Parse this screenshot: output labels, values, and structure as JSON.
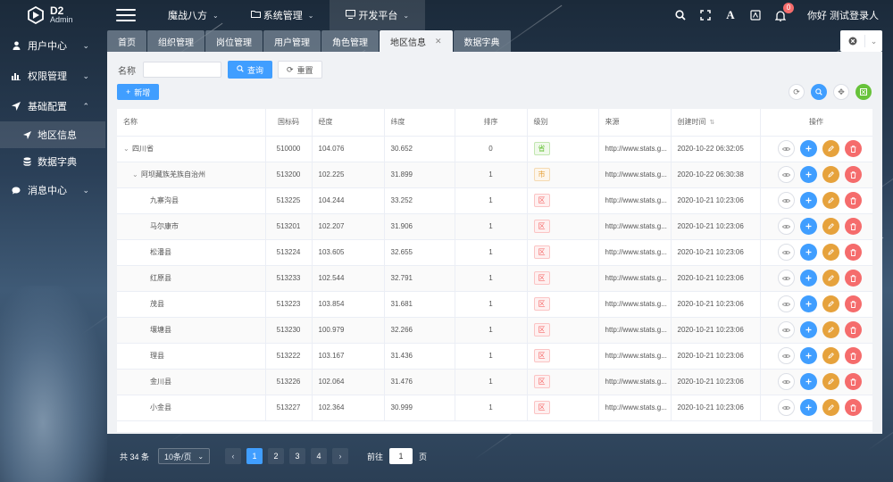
{
  "app": {
    "logo_title": "D2",
    "logo_subtitle": "Admin"
  },
  "top_nav": [
    {
      "label": "魔战八方",
      "active": false
    },
    {
      "label": "系统管理",
      "active": false
    },
    {
      "label": "开发平台",
      "active": true
    }
  ],
  "header": {
    "notification_count": "0",
    "greeting": "你好 测试登录人"
  },
  "sidebar": {
    "items": [
      {
        "label": "用户中心"
      },
      {
        "label": "权限管理"
      },
      {
        "label": "基础配置"
      },
      {
        "label": "地区信息"
      },
      {
        "label": "数据字典"
      },
      {
        "label": "消息中心"
      }
    ]
  },
  "tabs": [
    {
      "label": "首页"
    },
    {
      "label": "组织管理"
    },
    {
      "label": "岗位管理"
    },
    {
      "label": "用户管理"
    },
    {
      "label": "角色管理"
    },
    {
      "label": "地区信息",
      "active": true
    },
    {
      "label": "数据字典"
    }
  ],
  "search": {
    "label": "名称",
    "placeholder": "",
    "query_label": "查询",
    "reset_label": "重置"
  },
  "toolbar": {
    "add_label": "新增"
  },
  "table": {
    "columns": [
      "名称",
      "国标码",
      "经度",
      "纬度",
      "排序",
      "级别",
      "来源",
      "创建时间",
      "操作"
    ],
    "rows": [
      {
        "name": "四川省",
        "code": "510000",
        "lng": "104.076",
        "lat": "30.652",
        "sort": "0",
        "level": "省",
        "level_type": "green",
        "source": "http://www.stats.g...",
        "created": "2020-10-22 06:32:05",
        "indent": 0,
        "arrow": "⌄"
      },
      {
        "name": "阿坝藏族羌族自治州",
        "code": "513200",
        "lng": "102.225",
        "lat": "31.899",
        "sort": "1",
        "level": "市",
        "level_type": "orange",
        "source": "http://www.stats.g...",
        "created": "2020-10-22 06:30:38",
        "indent": 1,
        "arrow": "⌄"
      },
      {
        "name": "九寨沟县",
        "code": "513225",
        "lng": "104.244",
        "lat": "33.252",
        "sort": "1",
        "level": "区",
        "level_type": "red",
        "source": "http://www.stats.g...",
        "created": "2020-10-21 10:23:06",
        "indent": 2,
        "arrow": ""
      },
      {
        "name": "马尔康市",
        "code": "513201",
        "lng": "102.207",
        "lat": "31.906",
        "sort": "1",
        "level": "区",
        "level_type": "red",
        "source": "http://www.stats.g...",
        "created": "2020-10-21 10:23:06",
        "indent": 2,
        "arrow": ""
      },
      {
        "name": "松潘县",
        "code": "513224",
        "lng": "103.605",
        "lat": "32.655",
        "sort": "1",
        "level": "区",
        "level_type": "red",
        "source": "http://www.stats.g...",
        "created": "2020-10-21 10:23:06",
        "indent": 2,
        "arrow": ""
      },
      {
        "name": "红原县",
        "code": "513233",
        "lng": "102.544",
        "lat": "32.791",
        "sort": "1",
        "level": "区",
        "level_type": "red",
        "source": "http://www.stats.g...",
        "created": "2020-10-21 10:23:06",
        "indent": 2,
        "arrow": ""
      },
      {
        "name": "茂县",
        "code": "513223",
        "lng": "103.854",
        "lat": "31.681",
        "sort": "1",
        "level": "区",
        "level_type": "red",
        "source": "http://www.stats.g...",
        "created": "2020-10-21 10:23:06",
        "indent": 2,
        "arrow": ""
      },
      {
        "name": "壤塘县",
        "code": "513230",
        "lng": "100.979",
        "lat": "32.266",
        "sort": "1",
        "level": "区",
        "level_type": "red",
        "source": "http://www.stats.g...",
        "created": "2020-10-21 10:23:06",
        "indent": 2,
        "arrow": ""
      },
      {
        "name": "理县",
        "code": "513222",
        "lng": "103.167",
        "lat": "31.436",
        "sort": "1",
        "level": "区",
        "level_type": "red",
        "source": "http://www.stats.g...",
        "created": "2020-10-21 10:23:06",
        "indent": 2,
        "arrow": ""
      },
      {
        "name": "金川县",
        "code": "513226",
        "lng": "102.064",
        "lat": "31.476",
        "sort": "1",
        "level": "区",
        "level_type": "red",
        "source": "http://www.stats.g...",
        "created": "2020-10-21 10:23:06",
        "indent": 2,
        "arrow": ""
      },
      {
        "name": "小金县",
        "code": "513227",
        "lng": "102.364",
        "lat": "30.999",
        "sort": "1",
        "level": "区",
        "level_type": "red",
        "source": "http://www.stats.g...",
        "created": "2020-10-21 10:23:06",
        "indent": 2,
        "arrow": ""
      }
    ]
  },
  "pagination": {
    "total_label": "共 34 条",
    "page_size_label": "10条/页",
    "pages": [
      "1",
      "2",
      "3",
      "4"
    ],
    "current_page": "1",
    "goto_label": "前往",
    "goto_value": "1",
    "page_unit": "页"
  },
  "colors": {
    "primary": "#409eff",
    "warning": "#e6a23c",
    "danger": "#f56c6c",
    "success": "#67c23a"
  }
}
